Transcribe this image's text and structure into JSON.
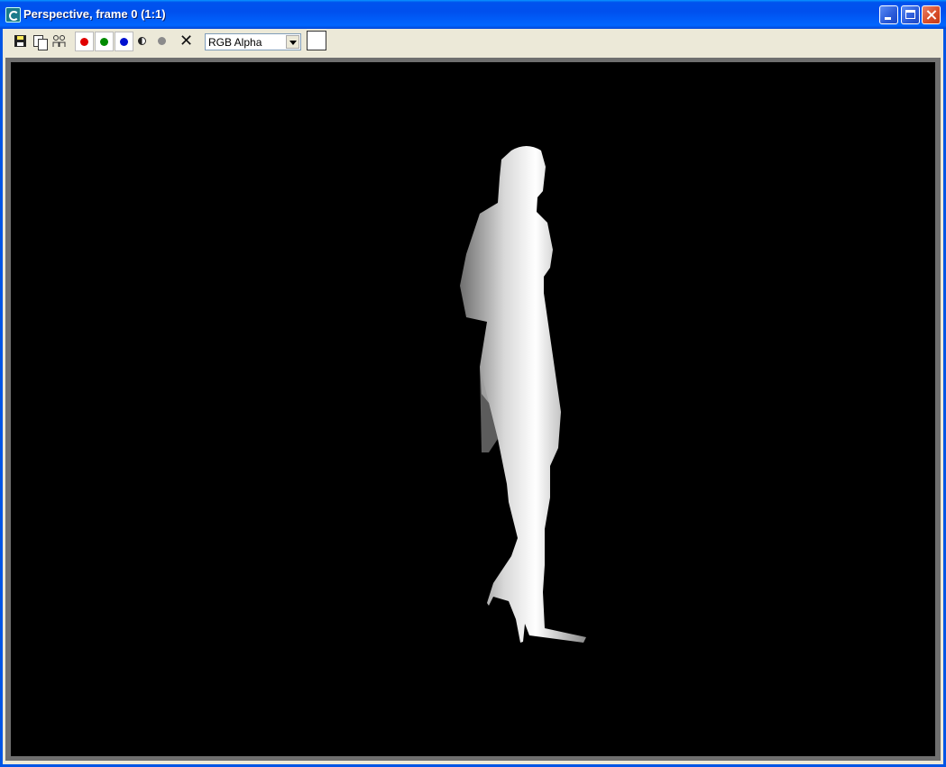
{
  "window": {
    "title": "Perspective, frame 0 (1:1)",
    "controls": [
      "minimize",
      "maximize",
      "close"
    ]
  },
  "toolbar": {
    "icons": [
      "save-icon",
      "copy-icon",
      "clone-icon",
      "red-channel",
      "green-channel",
      "blue-channel",
      "monochrome-icon",
      "gray-icon",
      "clear-icon"
    ],
    "channel_select": {
      "value": "RGB Alpha"
    },
    "swatch_color": "#ffffff"
  },
  "colors": {
    "title_bar": "#0053ee",
    "red_channel": "#e00000",
    "green_channel": "#008a00",
    "blue_channel": "#0010d0",
    "viewport_background": "#000000"
  }
}
